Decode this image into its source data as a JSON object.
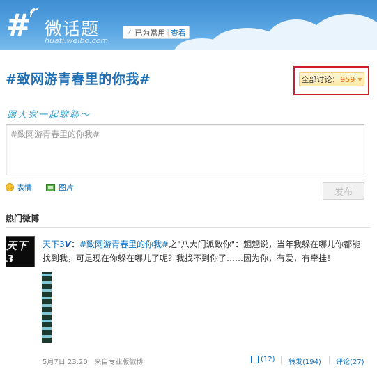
{
  "header": {
    "logo_glyph": "#",
    "title": "微话题",
    "domain": "huati.weibo.com",
    "check_mark": "✓",
    "set_common_label": "已为常用",
    "separator": "|",
    "view_link": "查看"
  },
  "topic": {
    "title": "#致网游青春里的你我#",
    "discussion_label": "全部讨论：",
    "discussion_count": "959",
    "discussion_arrow": "▼"
  },
  "composer": {
    "prompt": "跟大家一起聊聊～",
    "text_value": "#致网游青春里的你我#",
    "emoticon_label": "表情",
    "image_label": "图片",
    "publish_label": "发布"
  },
  "feed": {
    "section_title": "热门微博",
    "post": {
      "avatar_text": "天下3",
      "user_name": "天下3",
      "verified_mark": "V",
      "colon": "：",
      "hashtag": "#致网游青春里的你我#",
      "body": "之\"八大门派致你\"：魍魉说，当年我躲在哪儿你都能找到我，可是现在你躲在哪儿了呢？我找不到你了……因为你，有爱，有牵挂！",
      "date_time": "5月7日 23:20",
      "source": "来自专业版微博",
      "likes": "(12)",
      "reposts": "转发(194)",
      "comments": "评论(27)"
    }
  },
  "colors": {
    "header_blue": "#4a9ad9",
    "link_blue": "#0a6fbf",
    "highlight_red": "#cc1e2a",
    "count_orange": "#e47314"
  },
  "icons": [
    "logo-hash-icon",
    "checkmark-icon",
    "smiley-icon",
    "picture-icon",
    "like-thumb-icon"
  ]
}
